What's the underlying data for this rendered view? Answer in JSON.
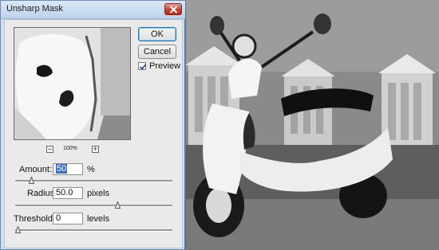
{
  "dialog": {
    "title": "Unsharp Mask",
    "ok_label": "OK",
    "cancel_label": "Cancel",
    "preview_label": "Preview",
    "preview_checked": true,
    "zoom": {
      "level": "100%",
      "out_label": "−",
      "in_label": "+"
    },
    "amount": {
      "label": "Amount:",
      "value": "50",
      "unit": "%",
      "slider_fraction": 0.09
    },
    "radius": {
      "label": "Radius:",
      "value": "50.0",
      "unit": "pixels",
      "slider_fraction": 0.66
    },
    "threshold": {
      "label": "Threshold:",
      "value": "0",
      "unit": "levels",
      "slider_fraction": 0.0
    }
  },
  "colors": {
    "dialog_frame": "#cfe0f2",
    "close_button": "#c9412c",
    "selection": "#3a6fc8"
  }
}
